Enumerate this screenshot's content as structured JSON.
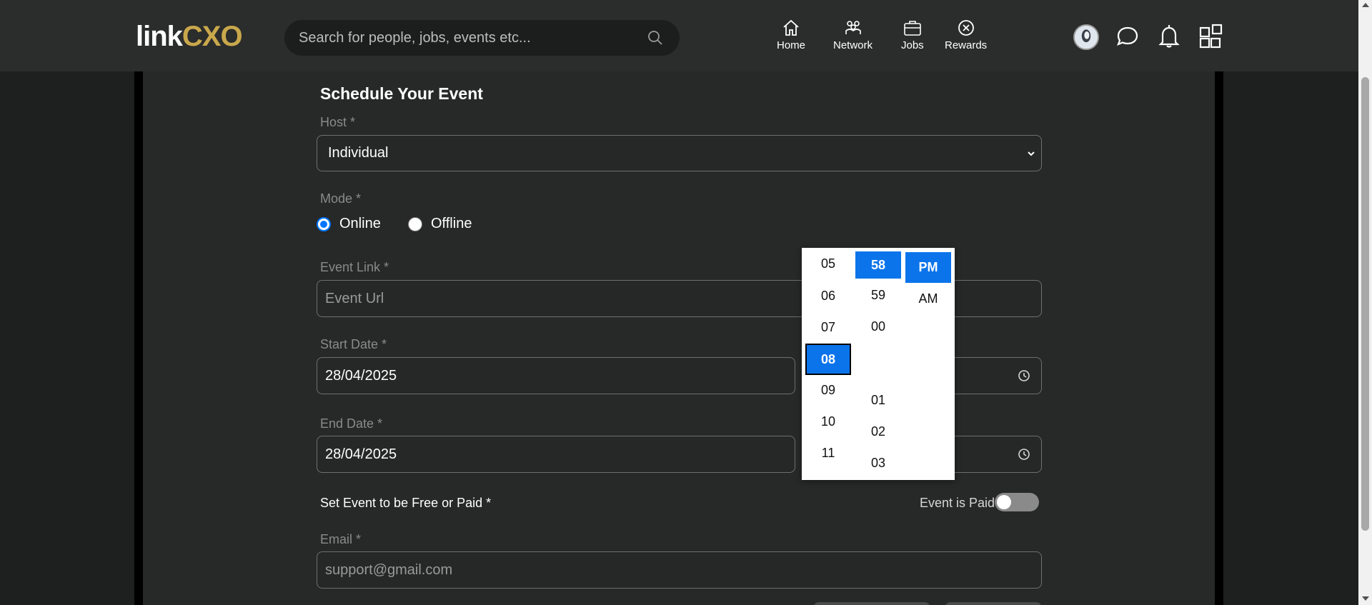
{
  "header": {
    "logo": {
      "part1": "link",
      "part2": "CXO"
    },
    "search_placeholder": "Search for people, jobs, events etc...",
    "nav": [
      {
        "label": "Home",
        "icon": "home-icon"
      },
      {
        "label": "Network",
        "icon": "network-icon"
      },
      {
        "label": "Jobs",
        "icon": "briefcase-icon"
      },
      {
        "label": "Rewards",
        "icon": "rewards-icon"
      }
    ],
    "right_icons": [
      "avatar",
      "chat-icon",
      "bell-icon",
      "apps-grid-icon"
    ]
  },
  "form": {
    "title": "Schedule Your Event",
    "host": {
      "label": "Host *",
      "value": "Individual"
    },
    "mode": {
      "label": "Mode *",
      "options": [
        {
          "label": "Online",
          "checked": true
        },
        {
          "label": "Offline",
          "checked": false
        }
      ]
    },
    "event_link": {
      "label": "Event Link *",
      "placeholder": "Event Url"
    },
    "start_date": {
      "label": "Start Date *",
      "value": "28/04/2025"
    },
    "end_date": {
      "label": "End Date *",
      "value": "28/04/2025"
    },
    "free_paid": {
      "label": "Set Event to be Free or Paid *",
      "toggle_label": "Event is Paid",
      "is_paid": false
    },
    "email": {
      "label": "Email *",
      "placeholder": "support@gmail.com"
    }
  },
  "time_picker": {
    "hours": [
      "05",
      "06",
      "07",
      "08",
      "09",
      "10",
      "11"
    ],
    "selected_hour": "08",
    "minutes_top": [
      "58",
      "59",
      "00"
    ],
    "minutes_bottom": [
      "01",
      "02",
      "03"
    ],
    "selected_minute": "58",
    "periods": [
      "PM",
      "AM"
    ],
    "selected_period": "PM"
  },
  "colors": {
    "header_bg": "#2b2c2c",
    "panel_bg": "#272828",
    "accent_gold": "#c9a84c",
    "selection_blue": "#0b74ea"
  }
}
